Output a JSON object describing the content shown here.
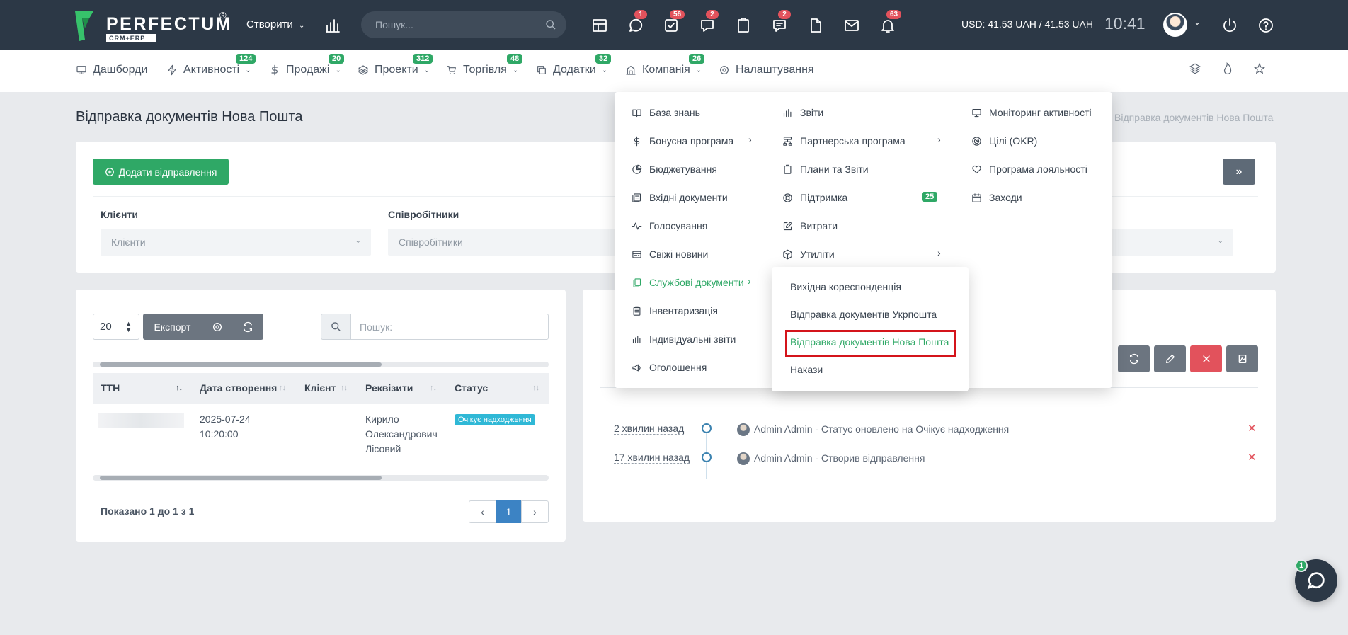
{
  "header": {
    "logo_text": "PERFECTUM",
    "logo_reg": "®",
    "logo_sub": "CRM+ERP",
    "create_label": "Створити",
    "search_placeholder": "Пошук...",
    "badges": {
      "chat": "1",
      "tasks": "56",
      "messages": "2",
      "comments": "2",
      "notifications": "63"
    },
    "currency": "USD: 41.53 UAH / 41.53 UAH",
    "clock": "10:41"
  },
  "nav": {
    "items": [
      {
        "label": "Дашборди",
        "icon": "monitor-icon",
        "badge": ""
      },
      {
        "label": "Активності",
        "icon": "bolt-icon",
        "badge": "124"
      },
      {
        "label": "Продажі",
        "icon": "dollar-icon",
        "badge": "20"
      },
      {
        "label": "Проекти",
        "icon": "layers-icon",
        "badge": "312"
      },
      {
        "label": "Торгівля",
        "icon": "cart-icon",
        "badge": "48"
      },
      {
        "label": "Додатки",
        "icon": "copy-icon",
        "badge": "32"
      },
      {
        "label": "Компанія",
        "icon": "building-icon",
        "badge": "26"
      },
      {
        "label": "Налаштування",
        "icon": "gear-icon",
        "badge": ""
      }
    ]
  },
  "page": {
    "title": "Відправка документів Нова Пошта",
    "breadcrumb": "Відправка документів Нова Пошта"
  },
  "filters": {
    "add_button": "Додати відправлення",
    "collapse_button": "»",
    "clients_label": "Клієнти",
    "clients_placeholder": "Клієнти",
    "employees_label": "Співробітники",
    "employees_placeholder": "Співробітники"
  },
  "table": {
    "page_size": "20",
    "export_label": "Експорт",
    "search_placeholder": "Пошук:",
    "columns": [
      "ТТН",
      "Дата створення",
      "Клієнт",
      "Реквізити",
      "Статус"
    ],
    "rows": [
      {
        "ttn": "",
        "date_line1": "2025-07-24",
        "date_line2": "10:20:00",
        "client": "",
        "req_line1": "Кирило",
        "req_line2": "Олександрович",
        "req_line3": "Лісовий",
        "status": "Очікує надходження"
      }
    ],
    "shown_text": "Показано 1 до 1 з 1",
    "pager": {
      "prev": "‹",
      "current": "1",
      "next": "›"
    }
  },
  "timeline": [
    {
      "time": "2 хвилин назад",
      "text": "Admin Admin - Статус оновлено на Очікує надходження"
    },
    {
      "time": "17 хвилин назад",
      "text": "Admin Admin - Створив відправлення"
    }
  ],
  "mega_menu": {
    "col1": [
      {
        "label": "База знань",
        "icon": "book-icon"
      },
      {
        "label": "Бонусна програма",
        "icon": "dollar-icon",
        "arrow": "›"
      },
      {
        "label": "Бюджетування",
        "icon": "pie-chart-icon"
      },
      {
        "label": "Вхідні документи",
        "icon": "inbox-docs-icon"
      },
      {
        "label": "Голосування",
        "icon": "pulse-icon"
      },
      {
        "label": "Свіжі новини",
        "icon": "newspaper-icon"
      },
      {
        "label": "Службові документи",
        "icon": "documents-icon",
        "arrow": "›"
      },
      {
        "label": "Інвентаризація",
        "icon": "clipboard-list-icon"
      },
      {
        "label": "Індивідуальні звіти",
        "icon": "bar-chart-icon"
      },
      {
        "label": "Оголошення",
        "icon": "megaphone-icon"
      }
    ],
    "col2": [
      {
        "label": "Звіти",
        "icon": "bar-chart-icon"
      },
      {
        "label": "Партнерська програма",
        "icon": "sitemap-icon",
        "arrow": "›"
      },
      {
        "label": "Плани та Звіти",
        "icon": "clipboard-icon"
      },
      {
        "label": "Підтримка",
        "icon": "lifebuoy-icon",
        "badge": "25"
      },
      {
        "label": "Витрати",
        "icon": "edit-icon"
      },
      {
        "label": "Утиліти",
        "icon": "box-icon",
        "arrow": "›"
      }
    ],
    "col3": [
      {
        "label": "Моніторинг активності",
        "icon": "monitor-icon"
      },
      {
        "label": "Цілі (OKR)",
        "icon": "target-icon"
      },
      {
        "label": "Програма лояльності",
        "icon": "heart-icon"
      },
      {
        "label": "Заходи",
        "icon": "calendar-icon"
      }
    ],
    "submenu": [
      "Вихідна кореспонденція",
      "Відправка документів Укрпошта",
      "Відправка документів Нова Пошта",
      "Накази"
    ]
  },
  "chat": {
    "badge": "1"
  },
  "colors": {
    "topbar": "#2c3846",
    "accent_green": "#2fa866",
    "danger": "#e2525c",
    "info": "#2fb8d6",
    "highlight_box": "#d4141b"
  }
}
